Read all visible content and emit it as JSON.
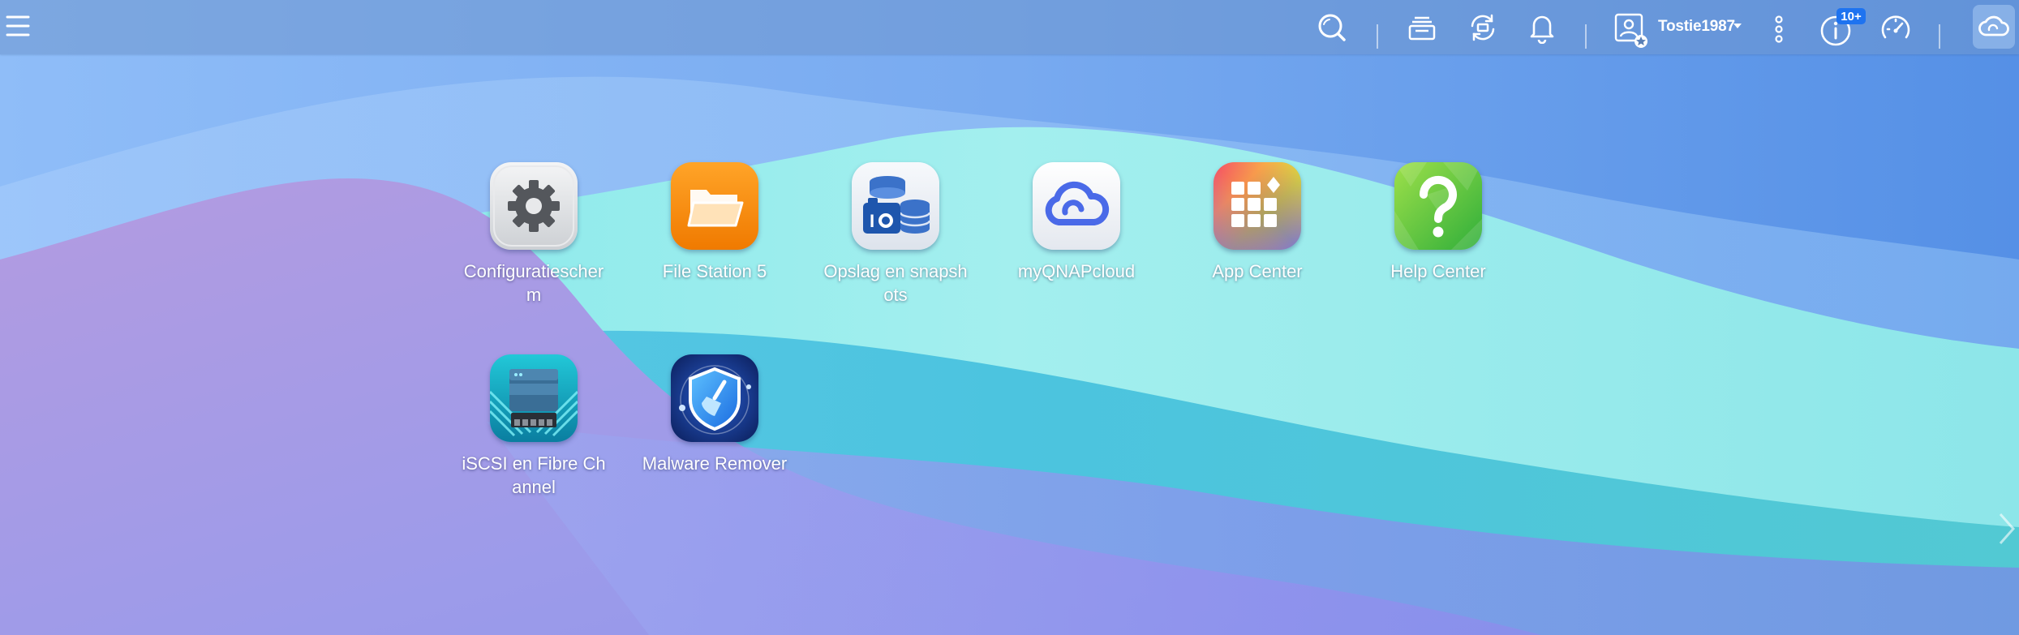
{
  "topbar": {
    "menu_icon": "hamburger-menu-icon",
    "username": "Tostie1987",
    "notification_count": "10+",
    "icons": [
      "search-icon",
      "task-stack-icon",
      "sync-icon",
      "bell-icon",
      "user-admin-icon",
      "more-vertical-icon",
      "info-icon",
      "dashboard-gauge-icon",
      "myqnapcloud-icon"
    ]
  },
  "apps": [
    {
      "label": "Configuratiescherm",
      "icon": "gear-icon"
    },
    {
      "label": "File Station 5",
      "icon": "folder-icon"
    },
    {
      "label": "Opslag en snapshots",
      "icon": "storage-snapshots-icon"
    },
    {
      "label": "myQNAPcloud",
      "icon": "cloud-icon"
    },
    {
      "label": "App Center",
      "icon": "app-grid-icon"
    },
    {
      "label": "Help Center",
      "icon": "question-mark-icon"
    },
    {
      "label": "iSCSI en Fibre Channel",
      "icon": "iscsi-server-icon"
    },
    {
      "label": "Malware Remover",
      "icon": "shield-broom-icon"
    }
  ],
  "colors": {
    "accent": "#1e73f0",
    "topbar": "#6e96cd",
    "wallpaper_blue": "#6b9fe8",
    "wallpaper_purple": "#a99be6",
    "wallpaper_teal": "#7fe3e6"
  }
}
